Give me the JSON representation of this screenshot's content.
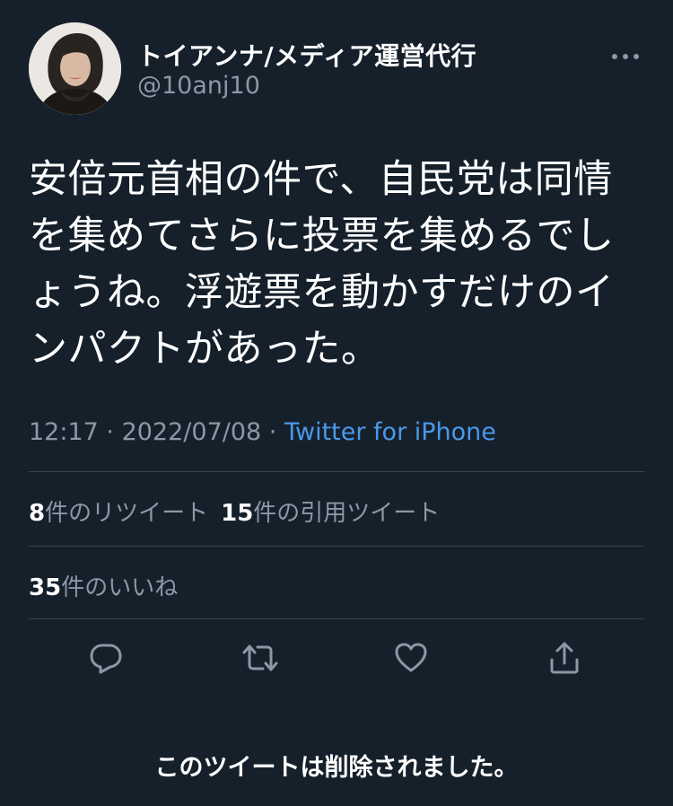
{
  "user": {
    "display_name": "トイアンナ/メディア運営代行",
    "handle": "@10anj10"
  },
  "tweet": {
    "text": "安倍元首相の件で、自民党は同情を集めてさらに投票を集めるでしょうね。浮遊票を動かすだけのインパクトがあった。",
    "time": "12:17",
    "separator": "·",
    "date": "2022/07/08",
    "source": "Twitter for iPhone"
  },
  "stats": {
    "retweet_count": "8",
    "retweet_label": "件のリツイート",
    "quote_count": "15",
    "quote_label": "件の引用ツイート",
    "like_count": "35",
    "like_label": "件のいいね"
  },
  "actions": {
    "reply_icon": "reply-icon",
    "retweet_icon": "retweet-icon",
    "like_icon": "heart-icon",
    "share_icon": "share-icon"
  },
  "footer": {
    "deleted_notice": "このツイートは削除されました。"
  },
  "colors": {
    "background": "#15202b",
    "text_primary": "#ffffff",
    "text_secondary": "#8b98a5",
    "link": "#4a99e9",
    "divider": "#38444d"
  }
}
